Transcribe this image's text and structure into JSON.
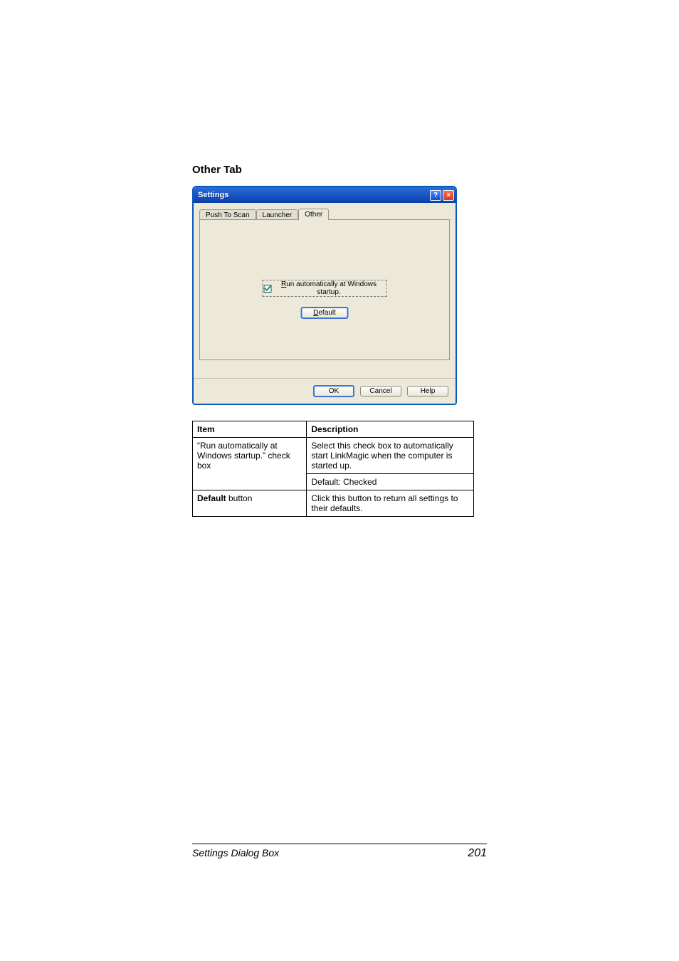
{
  "heading": "Other Tab",
  "dialog": {
    "title": "Settings",
    "help_glyph": "?",
    "close_glyph": "×",
    "tabs": [
      "Push To Scan",
      "Launcher",
      "Other"
    ],
    "active_tab_index": 2,
    "checkbox": {
      "checked": true,
      "underline": "R",
      "rest": "un automatically at Windows startup."
    },
    "default_btn": {
      "underline": "D",
      "rest": "efault"
    },
    "buttons": {
      "ok": "OK",
      "cancel": "Cancel",
      "help": "Help"
    }
  },
  "table": {
    "headers": [
      "Item",
      "Description"
    ],
    "rows": [
      {
        "item": "“Run automatically at Windows startup.” check box",
        "desc": "Select this check box to automatically start LinkMagic when the computer is started up.",
        "desc2": "Default: Checked",
        "bold_item": false
      },
      {
        "item_bold_part": "Default",
        "item_rest": " button",
        "desc": "Click this button to return all settings to their defaults.",
        "bold_item": true
      }
    ]
  },
  "footer": {
    "left": "Settings Dialog Box",
    "right": "201"
  }
}
